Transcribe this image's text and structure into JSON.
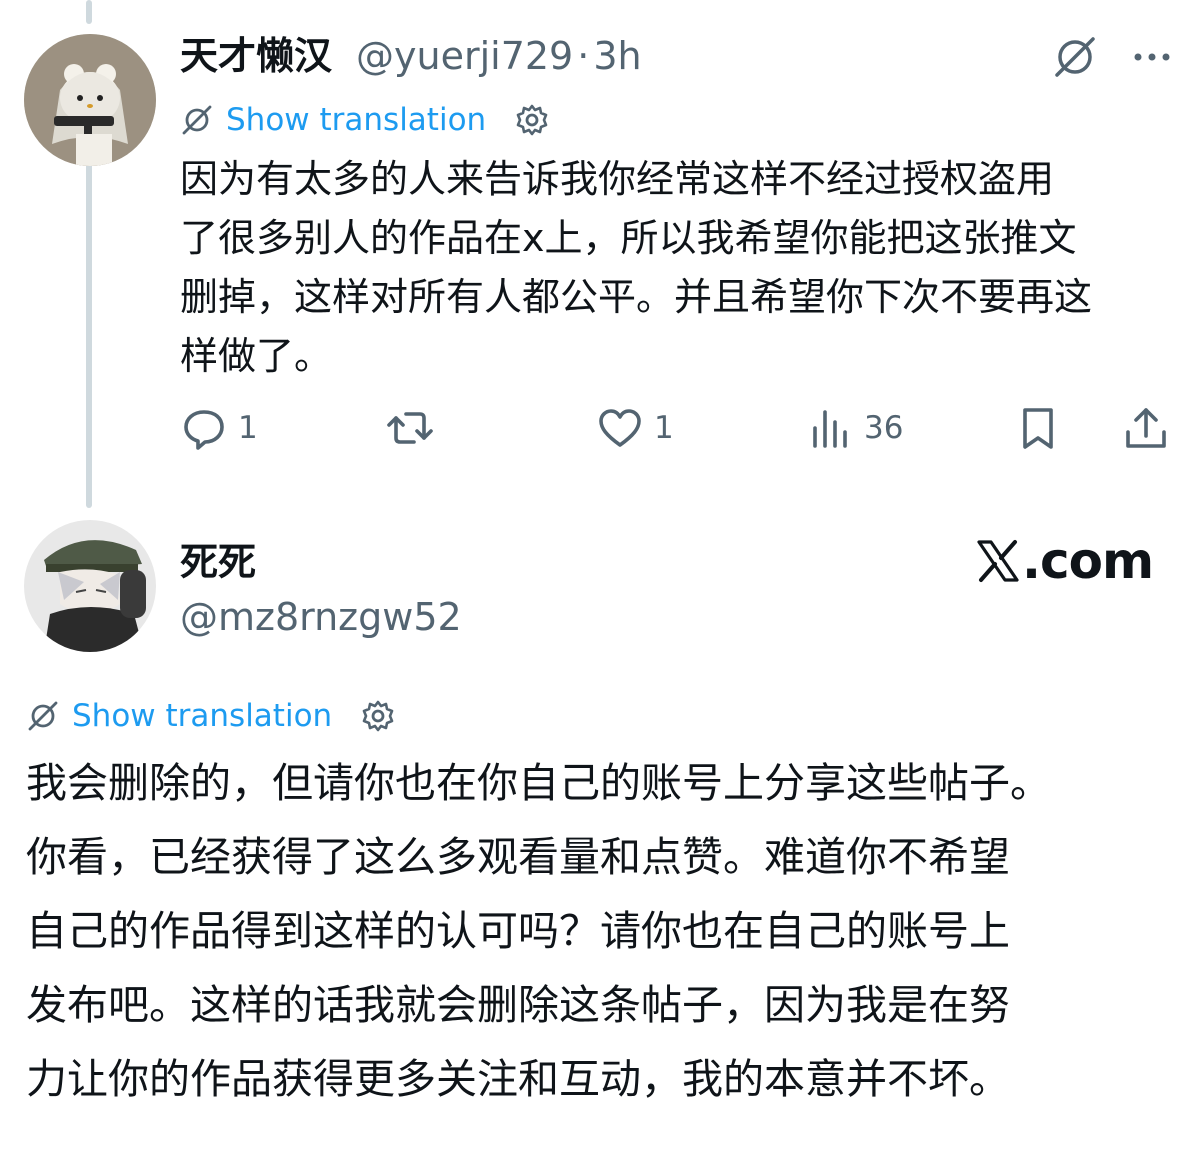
{
  "reply": {
    "author": {
      "display_name": "天才懒汉",
      "handle": "@yuerji729",
      "separator": "·",
      "time": "3h"
    },
    "translate": {
      "label": "Show translation"
    },
    "text": "因为有太多的人来告诉我你经常这样不经过授权盗用\n了很多别人的作品在x上，所以我希望你能把这张推文\n删掉，这样对所有人都公平。并且希望你下次不要再这\n样做了。",
    "actions": {
      "reply_count": "1",
      "retweet_count": "",
      "like_count": "1",
      "views_count": "36"
    },
    "icons": {
      "grok": "grok-slash-icon",
      "more": "more-dots-icon",
      "reply": "speech-bubble-icon",
      "retweet": "retweet-arrows-icon",
      "like": "heart-icon",
      "views": "bar-chart-icon",
      "bookmark": "bookmark-icon",
      "share": "share-upload-icon"
    }
  },
  "main_post": {
    "author": {
      "display_name": "死死",
      "handle": "@mz8rnzgw52"
    },
    "brand": ".com",
    "translate": {
      "label": "Show translation"
    },
    "text": "我会删除的，但请你也在你自己的账号上分享这些帖子。\n你看，已经获得了这么多观看量和点赞。难道你不希望\n自己的作品得到这样的认可吗？请你也在自己的账号上\n发布吧。这样的话我就会删除这条帖子，因为我是在努\n力让你的作品获得更多关注和互动，我的本意并不坏。"
  },
  "colors": {
    "link": "#1d9bf0",
    "text": "#0f1419",
    "secondary": "#536471",
    "thread_line": "#cfd9de"
  }
}
